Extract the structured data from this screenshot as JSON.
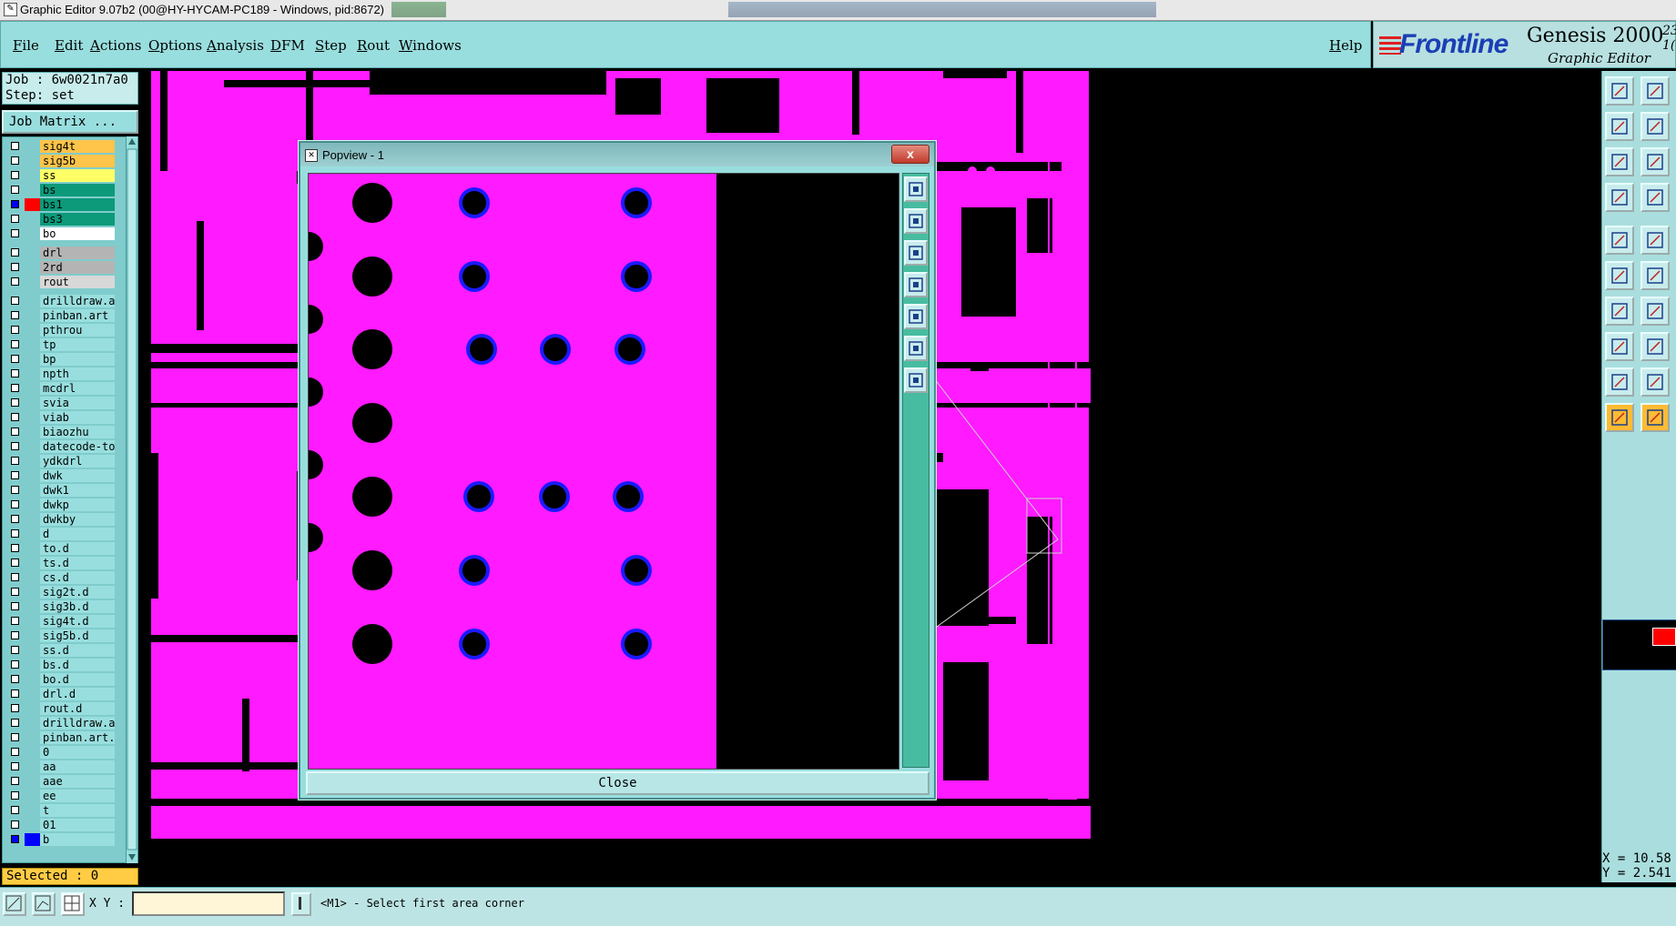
{
  "window": {
    "title": "Graphic Editor 9.07b2 (00@HY-HYCAM-PC189 - Windows, pid:8672)"
  },
  "menu": {
    "items": [
      "File",
      "Edit",
      "Actions",
      "Options",
      "Analysis",
      "DFM",
      "Step",
      "Rout",
      "Windows"
    ],
    "help": "Help"
  },
  "brand": {
    "logo": "Frontline",
    "product": "Genesis 2000",
    "version": "23 1(",
    "subtitle": "Graphic Editor"
  },
  "job": {
    "job_line": "Job : 6w0021n7a0",
    "step_line": "Step: set",
    "matrix_button": "Job Matrix ..."
  },
  "layers": [
    {
      "name": "sig4t",
      "bg": "#ffc44a",
      "group": 0
    },
    {
      "name": "sig5b",
      "bg": "#ffc44a",
      "group": 0
    },
    {
      "name": "ss",
      "bg": "#ffff66",
      "group": 0
    },
    {
      "name": "bs",
      "bg": "#0c9a7a",
      "group": 0
    },
    {
      "name": "bs1",
      "bg": "#0c9a7a",
      "group": 0,
      "active": true,
      "swatch": "#ff0000"
    },
    {
      "name": "bs3",
      "bg": "#0c9a7a",
      "group": 0
    },
    {
      "name": "bo",
      "bg": "#ffffff",
      "group": 0
    },
    {
      "name": "drl",
      "bg": "#b4b4b4",
      "group": 1
    },
    {
      "name": "2rd",
      "bg": "#b4b4b4",
      "group": 1
    },
    {
      "name": "rout",
      "bg": "#d8d8d8",
      "group": 1
    },
    {
      "name": "drilldraw.ar",
      "bg": "#99dede",
      "group": 2
    },
    {
      "name": "pinban.art",
      "bg": "#99dede",
      "group": 2
    },
    {
      "name": "pthrou",
      "bg": "#99dede",
      "group": 2
    },
    {
      "name": "tp",
      "bg": "#99dede",
      "group": 2
    },
    {
      "name": "bp",
      "bg": "#99dede",
      "group": 2
    },
    {
      "name": "npth",
      "bg": "#99dede",
      "group": 2
    },
    {
      "name": "mcdrl",
      "bg": "#99dede",
      "group": 2
    },
    {
      "name": "svia",
      "bg": "#99dede",
      "group": 2
    },
    {
      "name": "viab",
      "bg": "#99dede",
      "group": 2
    },
    {
      "name": "biaozhu",
      "bg": "#99dede",
      "group": 2
    },
    {
      "name": "datecode-to",
      "bg": "#99dede",
      "group": 2
    },
    {
      "name": "ydkdrl",
      "bg": "#99dede",
      "group": 2
    },
    {
      "name": "dwk",
      "bg": "#99dede",
      "group": 2
    },
    {
      "name": "dwk1",
      "bg": "#99dede",
      "group": 2
    },
    {
      "name": "dwkp",
      "bg": "#99dede",
      "group": 2
    },
    {
      "name": "dwkby",
      "bg": "#99dede",
      "group": 2
    },
    {
      "name": "d",
      "bg": "#99dede",
      "group": 2
    },
    {
      "name": "to.d",
      "bg": "#99dede",
      "group": 2
    },
    {
      "name": "ts.d",
      "bg": "#99dede",
      "group": 2
    },
    {
      "name": "cs.d",
      "bg": "#99dede",
      "group": 2
    },
    {
      "name": "sig2t.d",
      "bg": "#99dede",
      "group": 2
    },
    {
      "name": "sig3b.d",
      "bg": "#99dede",
      "group": 2
    },
    {
      "name": "sig4t.d",
      "bg": "#99dede",
      "group": 2
    },
    {
      "name": "sig5b.d",
      "bg": "#99dede",
      "group": 2
    },
    {
      "name": "ss.d",
      "bg": "#99dede",
      "group": 2
    },
    {
      "name": "bs.d",
      "bg": "#99dede",
      "group": 2
    },
    {
      "name": "bo.d",
      "bg": "#99dede",
      "group": 2
    },
    {
      "name": "drl.d",
      "bg": "#99dede",
      "group": 2
    },
    {
      "name": "rout.d",
      "bg": "#99dede",
      "group": 2
    },
    {
      "name": "drilldraw.a",
      "bg": "#99dede",
      "group": 2
    },
    {
      "name": "pinban.art.d",
      "bg": "#99dede",
      "group": 2
    },
    {
      "name": "0",
      "bg": "#99dede",
      "group": 2
    },
    {
      "name": "aa",
      "bg": "#99dede",
      "group": 2
    },
    {
      "name": "aae",
      "bg": "#99dede",
      "group": 2
    },
    {
      "name": "ee",
      "bg": "#99dede",
      "group": 2
    },
    {
      "name": "t",
      "bg": "#99dede",
      "group": 2
    },
    {
      "name": "01",
      "bg": "#99dede",
      "group": 2
    },
    {
      "name": "b",
      "bg": "#99dede",
      "group": 2,
      "checked": true,
      "swatch": "#0000ff"
    }
  ],
  "selected": "Selected : 0",
  "popview": {
    "title": "Popview - 1",
    "close_x": "x",
    "close_button": "Close"
  },
  "status": {
    "xy_label": "X Y :",
    "input_value": "",
    "message": "<M1> - Select first area corner"
  },
  "coords": {
    "x": "X = 10.58",
    "y": "Y = 2.541"
  },
  "colors": {
    "copper": "#ff1aff",
    "background": "#000000",
    "ring": "#1a1aff",
    "panel": "#99dede",
    "highlight": "#ffbb33"
  }
}
